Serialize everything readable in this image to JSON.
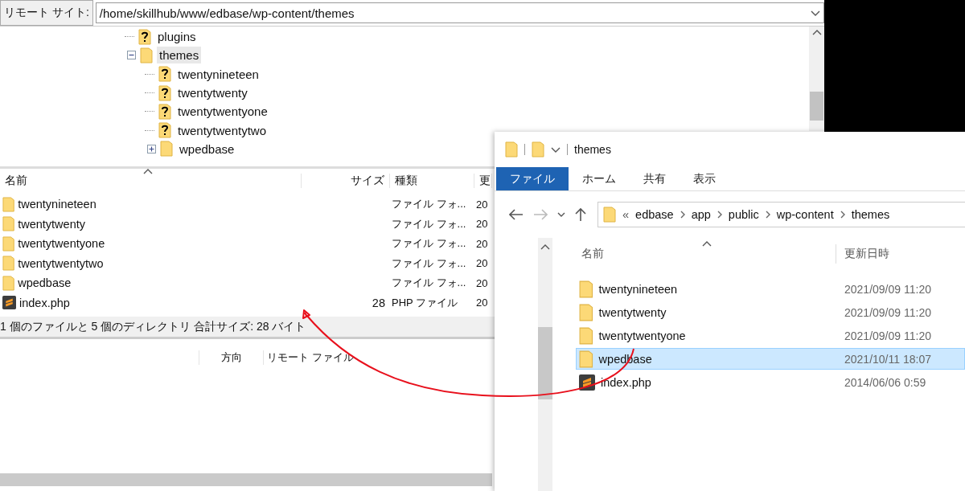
{
  "remote_site": {
    "label": "リモート サイト:",
    "path": "/home/skillhub/www/edbase/wp-content/themes"
  },
  "tree": {
    "items": [
      {
        "name": "plugins",
        "kind": "unknown",
        "selected": false
      },
      {
        "name": "themes",
        "kind": "folder",
        "selected": true,
        "expanded": true,
        "children": [
          {
            "name": "twentynineteen",
            "kind": "unknown",
            "selected": false
          },
          {
            "name": "twentytwenty",
            "kind": "unknown",
            "selected": false
          },
          {
            "name": "twentytwentyone",
            "kind": "unknown",
            "selected": false
          },
          {
            "name": "twentytwentytwo",
            "kind": "unknown",
            "selected": false
          },
          {
            "name": "wpedbase",
            "kind": "folder",
            "selected": false,
            "expanded": false
          }
        ]
      }
    ]
  },
  "file_list": {
    "columns": [
      "名前",
      "サイズ",
      "種類",
      "更"
    ],
    "rows": [
      {
        "name": "twentynineteen",
        "kind": "folder",
        "type": "ファイル フォ...",
        "modified": "20"
      },
      {
        "name": "twentytwenty",
        "kind": "folder",
        "type": "ファイル フォ...",
        "modified": "20"
      },
      {
        "name": "twentytwentyone",
        "kind": "folder",
        "type": "ファイル フォ...",
        "modified": "20"
      },
      {
        "name": "twentytwentytwo",
        "kind": "folder",
        "type": "ファイル フォ...",
        "modified": "20"
      },
      {
        "name": "wpedbase",
        "kind": "folder",
        "type": "ファイル フォ...",
        "modified": "20"
      },
      {
        "name": "index.php",
        "kind": "php",
        "size": "28",
        "type": "PHP ファイル",
        "modified": "20"
      }
    ],
    "status": "1 個のファイルと 5 個のディレクトリ 合計サイズ: 28 バイト"
  },
  "queue": {
    "columns": [
      "方向",
      "リモート ファイル"
    ]
  },
  "explorer": {
    "title": "themes",
    "ribbon_tabs": [
      {
        "label": "ファイル",
        "kind": "file"
      },
      {
        "label": "ホーム",
        "kind": "tab"
      },
      {
        "label": "共有",
        "kind": "tab"
      },
      {
        "label": "表示",
        "kind": "tab"
      }
    ],
    "nav_buttons": [
      {
        "kind": "back",
        "disabled": false
      },
      {
        "kind": "forward",
        "disabled": true
      },
      {
        "kind": "recent",
        "disabled": false
      },
      {
        "kind": "up",
        "disabled": false
      }
    ],
    "breadcrumb": {
      "overflow": "«",
      "parts": [
        "edbase",
        "app",
        "public",
        "wp-content",
        "themes"
      ]
    },
    "columns": [
      "名前",
      "更新日時"
    ],
    "rows": [
      {
        "name": "twentynineteen",
        "kind": "folder",
        "modified": "2021/09/09 11:20",
        "selected": false
      },
      {
        "name": "twentytwenty",
        "kind": "folder",
        "modified": "2021/09/09 11:20",
        "selected": false
      },
      {
        "name": "twentytwentyone",
        "kind": "folder",
        "modified": "2021/09/09 11:20",
        "selected": false
      },
      {
        "name": "wpedbase",
        "kind": "folder",
        "modified": "2021/10/11 18:07",
        "selected": true
      },
      {
        "name": "index.php",
        "kind": "php",
        "modified": "2014/06/06 0:59",
        "selected": false
      }
    ]
  }
}
